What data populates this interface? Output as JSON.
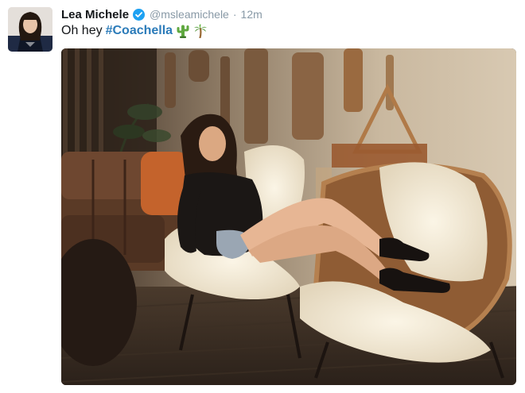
{
  "tweet": {
    "author_name": "Lea Michele",
    "handle": "@msleamichele",
    "separator": "·",
    "time": "12m",
    "text_prefix": "Oh hey",
    "hashtag": "#Coachella",
    "emojis": [
      "cactus-icon",
      "palm-tree-icon"
    ]
  },
  "colors": {
    "link": "#2b7bb9",
    "meta": "#8899a6",
    "verified": "#1da1f2"
  }
}
